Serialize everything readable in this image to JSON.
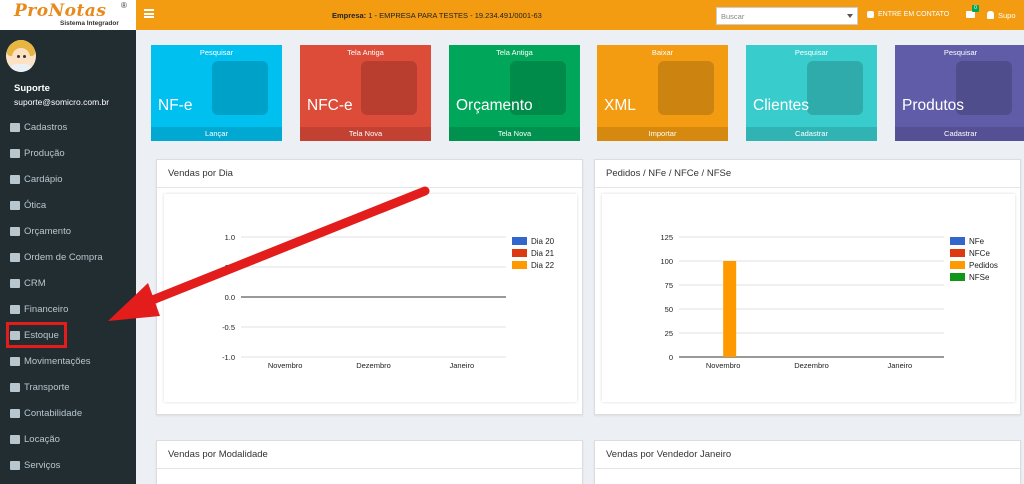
{
  "brand": {
    "name": "ProNotas",
    "reg": "®",
    "subtitle": "Sistema Integrador"
  },
  "user": {
    "name": "Suporte",
    "email": "suporte@somicro.com.br"
  },
  "sidebar": {
    "items": [
      {
        "label": "Cadastros",
        "icon": "document-icon"
      },
      {
        "label": "Produção",
        "icon": "factory-icon"
      },
      {
        "label": "Cardápio",
        "icon": "cutlery-icon"
      },
      {
        "label": "Ótica",
        "icon": "eye-icon"
      },
      {
        "label": "Orçamento",
        "icon": "file-icon"
      },
      {
        "label": "Ordem de Compra",
        "icon": "copy-icon"
      },
      {
        "label": "CRM",
        "icon": "crm-icon"
      },
      {
        "label": "Financeiro",
        "icon": "money-icon"
      },
      {
        "label": "Estoque",
        "icon": "cubes-icon"
      },
      {
        "label": "Movimentações",
        "icon": "list-icon"
      },
      {
        "label": "Transporte",
        "icon": "truck-icon"
      },
      {
        "label": "Contabilidade",
        "icon": "balance-icon"
      },
      {
        "label": "Locação",
        "icon": "briefcase-icon"
      },
      {
        "label": "Serviços",
        "icon": "users-icon"
      }
    ]
  },
  "topbar": {
    "empresa_label": "Empresa:",
    "empresa_value": "1 - EMPRESA PARA TESTES - 19.234.491/0001-63",
    "search_placeholder": "Buscar",
    "contact_label": "ENTRE EM CONTATO",
    "mail_badge": "0",
    "user_short": "Supo"
  },
  "tiles": [
    {
      "top": "Pesquisar",
      "main": "NF-e",
      "foot": "Lançar",
      "color": "#00c0ef",
      "icon": "book-icon"
    },
    {
      "top": "Tela Antiga",
      "main": "NFC-e",
      "foot": "Tela Nova",
      "color": "#dd4b39",
      "icon": "printer-icon"
    },
    {
      "top": "Tela Antiga",
      "main": "Orçamento",
      "foot": "Tela Nova",
      "color": "#00a65a",
      "icon": "bag-icon"
    },
    {
      "top": "Baixar",
      "main": "XML",
      "foot": "Importar",
      "color": "#f39c12",
      "icon": "scale-icon"
    },
    {
      "top": "Pesquisar",
      "main": "Clientes",
      "foot": "Cadastrar",
      "color": "#39cccc",
      "icon": "users-icon"
    },
    {
      "top": "Pesquisar",
      "main": "Produtos",
      "foot": "Cadastrar",
      "color": "#605ca8",
      "icon": "cart-icon"
    }
  ],
  "panels": {
    "vendas_dia": "Vendas por Dia",
    "pedidos": "Pedidos / NFe / NFCe / NFSe",
    "vendas_modalidade": "Vendas por Modalidade",
    "vendas_vendedor": "Vendas por Vendedor Janeiro"
  },
  "colors": {
    "arrow": "#e31c1c"
  },
  "chart_data": [
    {
      "type": "bar",
      "title": "Vendas por Dia",
      "categories": [
        "Novembro",
        "Dezembro",
        "Janeiro"
      ],
      "series": [
        {
          "name": "Dia 20",
          "color": "#3366cc",
          "values": [
            0,
            0,
            0
          ]
        },
        {
          "name": "Dia 21",
          "color": "#dc3912",
          "values": [
            0,
            0,
            0
          ]
        },
        {
          "name": "Dia 22",
          "color": "#ff9900",
          "values": [
            0,
            0,
            0
          ]
        }
      ],
      "yticks": [
        "1.0",
        "0.5",
        "0.0",
        "-0.5",
        "-1.0"
      ],
      "ylim": [
        -1,
        1
      ],
      "grid": true,
      "legend": "right"
    },
    {
      "type": "bar",
      "title": "Pedidos / NFe / NFCe / NFSe",
      "categories": [
        "Novembro",
        "Dezembro",
        "Janeiro"
      ],
      "series": [
        {
          "name": "NFe",
          "color": "#3366cc",
          "values": [
            0,
            0,
            0
          ]
        },
        {
          "name": "NFCe",
          "color": "#dc3912",
          "values": [
            0,
            0,
            0
          ]
        },
        {
          "name": "Pedidos",
          "color": "#ff9900",
          "values": [
            100,
            0,
            0
          ]
        },
        {
          "name": "NFSe",
          "color": "#109618",
          "values": [
            0,
            0,
            0
          ]
        }
      ],
      "yticks": [
        "125",
        "100",
        "75",
        "50",
        "25",
        "0"
      ],
      "ylim": [
        0,
        125
      ],
      "grid": true,
      "legend": "right"
    }
  ]
}
